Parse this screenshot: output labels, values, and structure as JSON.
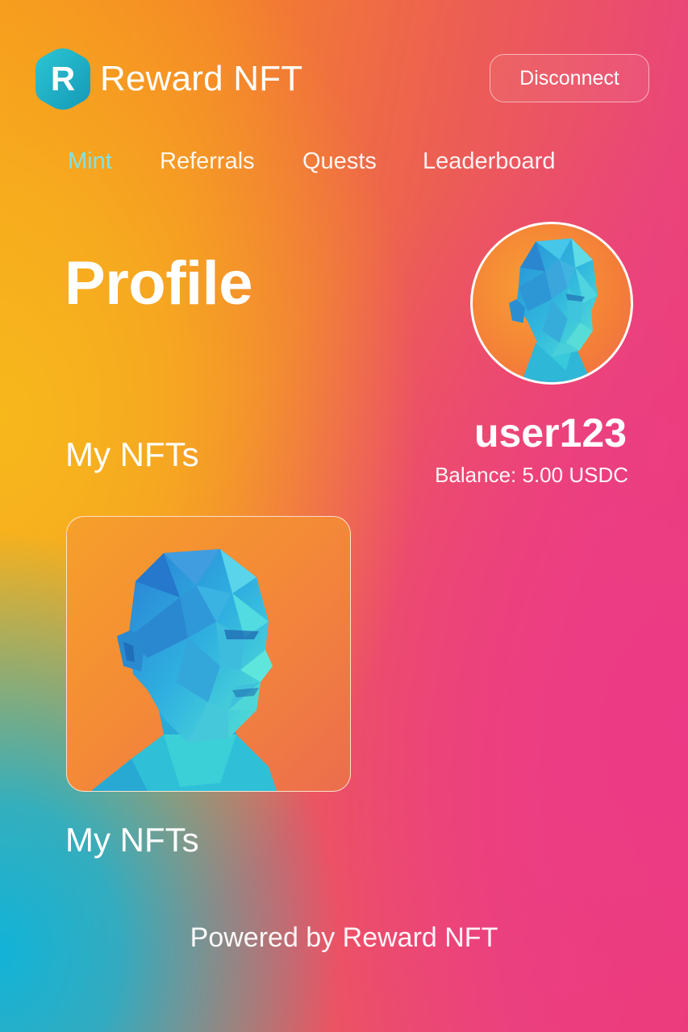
{
  "header": {
    "logo_letter": "R",
    "app_name": "Reward NFT",
    "disconnect_label": "Disconnect"
  },
  "nav": {
    "items": [
      {
        "label": "Mint",
        "active": true
      },
      {
        "label": "Referrals",
        "active": false
      },
      {
        "label": "Quests",
        "active": false
      },
      {
        "label": "Leaderboard",
        "active": false
      }
    ]
  },
  "profile": {
    "title": "Profile",
    "username": "user123",
    "balance": "Balance: 5.00 USDC",
    "avatar_icon": "lowpoly-head-avatar"
  },
  "nfts": {
    "section_title": "My NFTs",
    "items": [
      {
        "image_icon": "lowpoly-head-nft"
      }
    ],
    "footer_section_title": "My NFTs"
  },
  "footer": {
    "text": "Powered by Reward NFT"
  },
  "colors": {
    "nav_active": "#7fe3e8",
    "logo_hex": "#1fb6c9",
    "accent_cyan": "#3cc7d8",
    "bg_orange": "#f7921e",
    "bg_pink": "#ea4678"
  }
}
